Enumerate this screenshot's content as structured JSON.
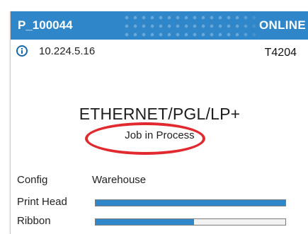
{
  "header": {
    "printer_id": "P_100044",
    "status": "ONLINE"
  },
  "connection": {
    "icon": "info-icon",
    "ip_address": "10.224.5.16",
    "model": "T4204"
  },
  "main": {
    "emulation": "ETHERNET/PGL/LP+",
    "job_state": "Job in Process"
  },
  "details": {
    "config_label": "Config",
    "config_value": "Warehouse",
    "print_head_label": "Print Head",
    "print_head_level": 1.0,
    "ribbon_label": "Ribbon",
    "ribbon_level": 0.52
  },
  "colors": {
    "accent": "#2f86c8",
    "highlight": "#e12a2f"
  }
}
